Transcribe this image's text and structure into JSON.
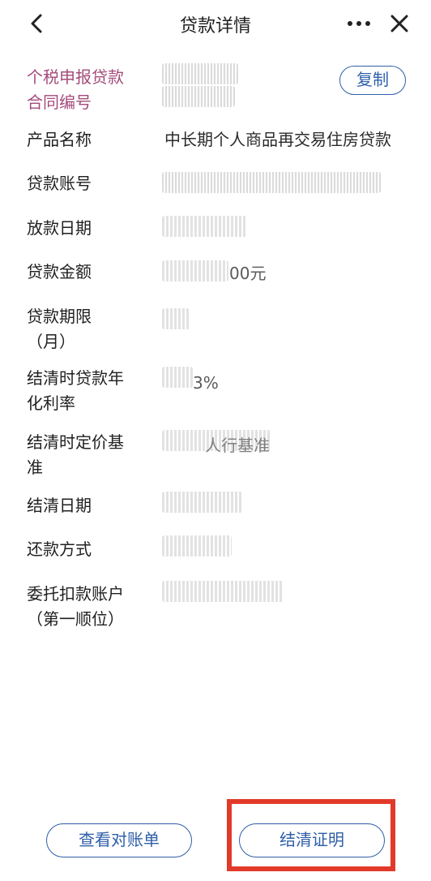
{
  "header": {
    "title": "贷款详情",
    "back_icon": "chevron-left-icon",
    "more_icon": "more-horizontal-icon",
    "close_icon": "close-icon"
  },
  "colors": {
    "accent_label": "#a44b7c",
    "button_blue": "#2f5fa8",
    "highlight_red": "#e23a2a"
  },
  "fields": {
    "contract_no": {
      "label_line1": "个税申报贷款",
      "label_line2": "合同编号",
      "copy_label": "复制"
    },
    "product_name": {
      "label": "产品名称",
      "value": "中长期个人商品再交易住房贷款"
    },
    "loan_account": {
      "label": "贷款账号"
    },
    "disbursement_date": {
      "label": "放款日期"
    },
    "loan_amount": {
      "label": "贷款金额",
      "visible_suffix": "00元"
    },
    "loan_term": {
      "label_line1": "贷款期限",
      "label_line2": "（月）"
    },
    "annual_rate": {
      "label_line1": "结清时贷款年",
      "label_line2": "化利率",
      "visible_suffix": "3%"
    },
    "pricing_base": {
      "label_line1": "结清时定价基",
      "label_line2": "准",
      "visible_fragment": "人行基准"
    },
    "settlement_date": {
      "label": "结清日期"
    },
    "repayment_method": {
      "label": "还款方式"
    },
    "debit_account": {
      "label_line1": "委托扣款账户",
      "label_line2": "（第一顺位）"
    }
  },
  "actions": {
    "statement_label": "查看对账单",
    "certificate_label": "结清证明"
  }
}
